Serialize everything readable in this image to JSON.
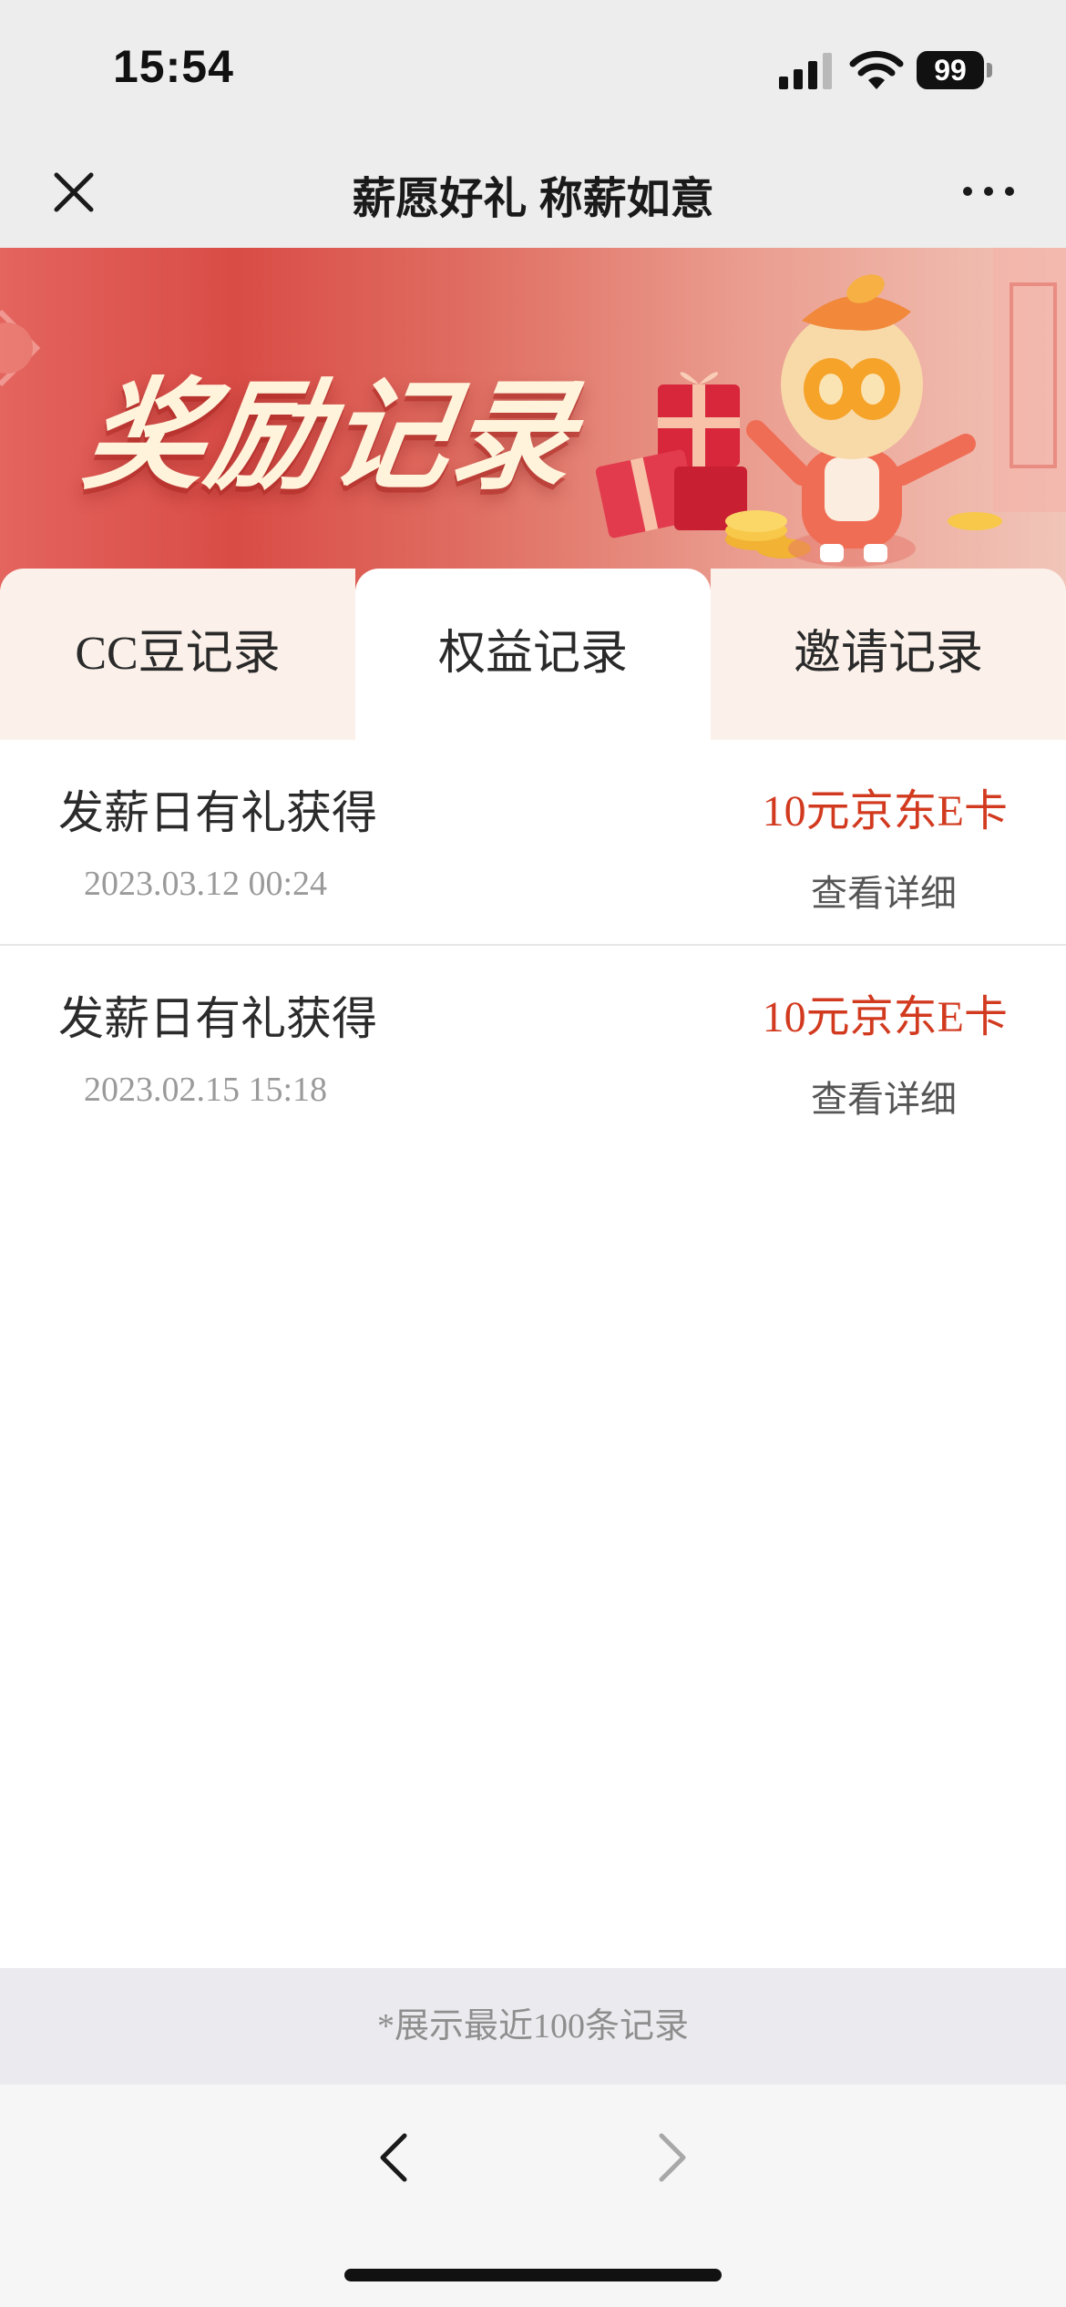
{
  "status_bar": {
    "time": "15:54",
    "battery_level": "99"
  },
  "nav": {
    "title": "薪愿好礼 称薪如意"
  },
  "banner": {
    "title": "奖励记录"
  },
  "tabs": [
    {
      "label": "CC豆记录",
      "active": false
    },
    {
      "label": "权益记录",
      "active": true
    },
    {
      "label": "邀请记录",
      "active": false
    }
  ],
  "records": [
    {
      "title": "发薪日有礼获得",
      "date": "2023.03.12 00:24",
      "reward": "10元京东E卡",
      "action": "查看详细"
    },
    {
      "title": "发薪日有礼获得",
      "date": "2023.02.15 15:18",
      "reward": "10元京东E卡",
      "action": "查看详细"
    }
  ],
  "footer": {
    "note": "*展示最近100条记录"
  },
  "colors": {
    "accent": "#d23a1f",
    "banner_red": "#d94c46",
    "tab_inactive_bg": "#fbf1ea"
  }
}
